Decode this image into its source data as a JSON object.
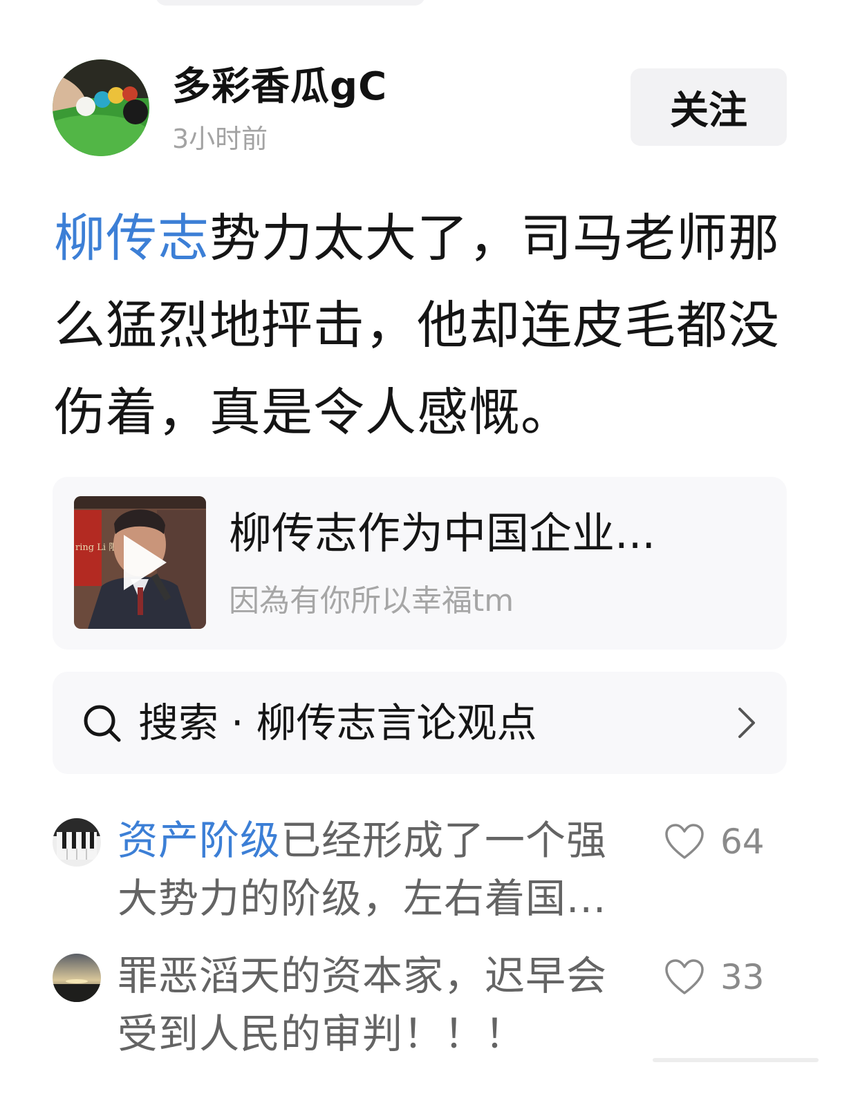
{
  "author": {
    "name": "多彩香瓜gC",
    "time": "3小时前",
    "follow_label": "关注"
  },
  "post": {
    "mention": "柳传志",
    "text": "势力太大了，司马老师那么猛烈地抨击，他却连皮毛都没伤着，真是令人感慨。"
  },
  "video_card": {
    "title": "柳传志作为中国企业...",
    "author": "因為有你所以幸福tm",
    "thumb_text": "ring Li 限"
  },
  "search": {
    "prefix": "搜索",
    "separator": "·",
    "query": "柳传志言论观点"
  },
  "comments": [
    {
      "mention": "资产阶级",
      "text": "已经形成了一个强大势力的阶级，左右着国...",
      "likes": "64"
    },
    {
      "mention": "",
      "text": "罪恶滔天的资本家，迟早会受到人民的审判！！！",
      "likes": "33"
    }
  ],
  "colors": {
    "mention": "#3c7fd6",
    "muted": "#a3a3a3",
    "card_bg": "#f8f8fa",
    "button_bg": "#f2f2f4"
  },
  "icons": [
    "play-icon",
    "search-icon",
    "chevron-right-icon",
    "heart-icon"
  ]
}
